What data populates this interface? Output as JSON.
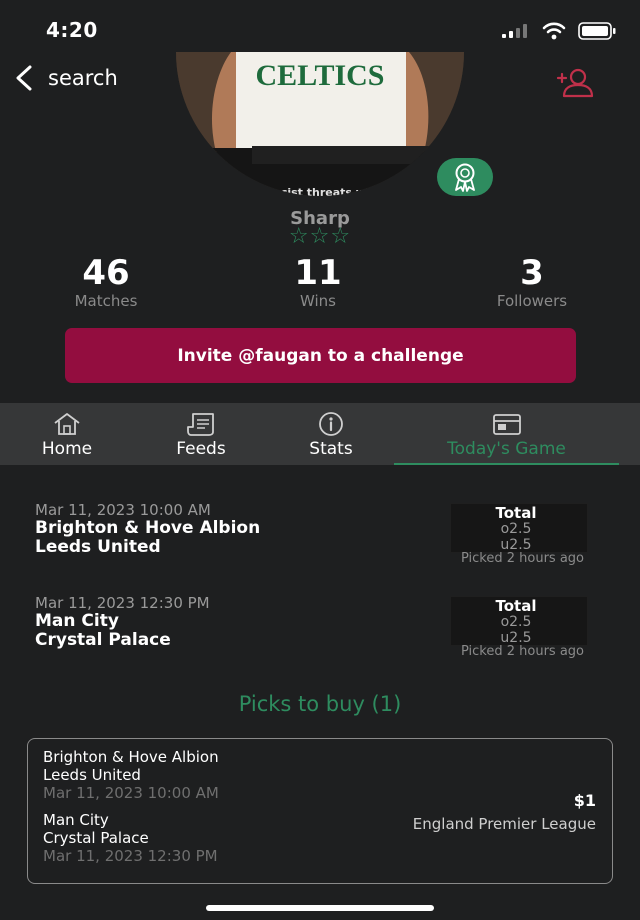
{
  "status_bar": {
    "time": "4:20"
  },
  "header": {
    "back_label": "search",
    "title": "@faugan"
  },
  "profile": {
    "avatar_text": "CELTICS",
    "avatar_caption": "racist threats wit",
    "rank": "Sharp",
    "stars": "☆☆☆",
    "stats": [
      {
        "value": "46",
        "label": "Matches"
      },
      {
        "value": "11",
        "label": "Wins"
      },
      {
        "value": "3",
        "label": "Followers"
      }
    ],
    "invite_label": "Invite @faugan to a challenge"
  },
  "tabs": [
    {
      "label": "Home",
      "icon": "home-icon"
    },
    {
      "label": "Feeds",
      "icon": "feeds-icon"
    },
    {
      "label": "Stats",
      "icon": "info-icon"
    },
    {
      "label": "Today's Game",
      "icon": "calendar-icon",
      "active": true
    }
  ],
  "matches": [
    {
      "date": "Mar 11, 2023 10:00 AM",
      "home": "Brighton & Hove Albion",
      "away": "Leeds United",
      "pick_title": "Total",
      "options": [
        "o2.5",
        "u2.5"
      ],
      "picked": "Picked 2 hours ago"
    },
    {
      "date": "Mar 11, 2023 12:30 PM",
      "home": "Man City",
      "away": "Crystal Palace",
      "pick_title": "Total",
      "options": [
        "o2.5",
        "u2.5"
      ],
      "picked": "Picked 2 hours ago"
    }
  ],
  "picks_to_buy": {
    "title": "Picks to buy (1)",
    "card": {
      "games": [
        {
          "home": "Brighton & Hove Albion",
          "away": "Leeds United",
          "date": "Mar 11, 2023 10:00 AM"
        },
        {
          "home": "Man City",
          "away": "Crystal Palace",
          "date": "Mar 11, 2023 12:30 PM"
        }
      ],
      "price": "$1",
      "league": "England Premier League"
    }
  },
  "colors": {
    "accent": "#2e8c5f",
    "brand": "#930d3f",
    "background": "#1e1f20",
    "tabbar": "#363738"
  }
}
